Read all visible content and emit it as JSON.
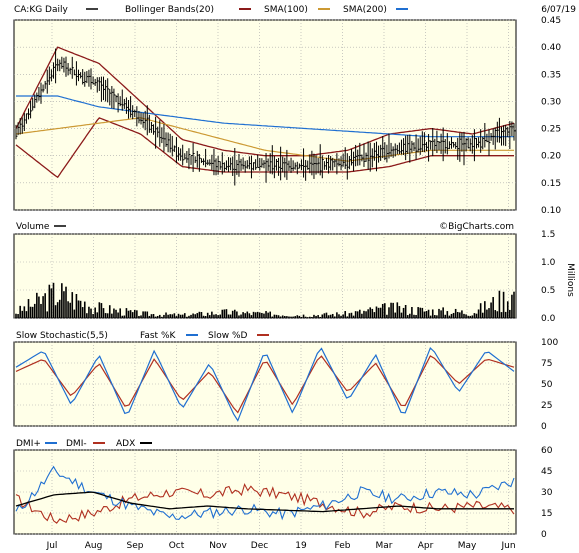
{
  "header": {
    "ticker_label": "CA:KG Daily",
    "date": "6/07/19",
    "legend": [
      {
        "label": "Bollinger Bands(20)",
        "color": "#8b1a1a"
      },
      {
        "label": "SMA(100)",
        "color": "#aa1111"
      },
      {
        "label": "SMA(200)",
        "color": "#1f6fd1"
      }
    ]
  },
  "watermark": "©BigCharts.com",
  "colors": {
    "background": "#ffffe8",
    "price": "#000000",
    "bollinger": "#8b1a1a",
    "sma100": "#cc9933",
    "sma200": "#1f6fd1",
    "volume": "#000000",
    "fast_k": "#1f6fd1",
    "slow_d": "#b03020",
    "dmi_plus": "#1f6fd1",
    "dmi_minus": "#b03020",
    "adx": "#000000",
    "grid": "#a8a8a8"
  },
  "x_axis": {
    "labels": [
      "Jul",
      "Aug",
      "Sep",
      "Oct",
      "Nov",
      "Dec",
      "19",
      "Feb",
      "Mar",
      "Apr",
      "May",
      "Jun"
    ]
  },
  "chart_data": [
    {
      "type": "line",
      "name": "price",
      "title": "CA:KG Daily",
      "yticks": [
        "0.45",
        "0.40",
        "0.35",
        "0.30",
        "0.25",
        "0.20",
        "0.15",
        "0.10"
      ],
      "ylim": [
        0.1,
        0.45
      ],
      "categories": [
        "Jun",
        "Jul",
        "Aug",
        "Sep",
        "Oct",
        "Nov",
        "Dec",
        "19",
        "Feb",
        "Mar",
        "Apr",
        "May",
        "Jun"
      ],
      "series": [
        {
          "name": "CA:KG Daily",
          "values": [
            0.24,
            0.37,
            0.33,
            0.27,
            0.2,
            0.18,
            0.185,
            0.18,
            0.19,
            0.21,
            0.22,
            0.22,
            0.25
          ]
        },
        {
          "name": "Bollinger Bands(20) upper",
          "values": [
            0.25,
            0.4,
            0.37,
            0.3,
            0.23,
            0.21,
            0.2,
            0.2,
            0.21,
            0.24,
            0.25,
            0.24,
            0.26
          ]
        },
        {
          "name": "Bollinger Bands(20) lower",
          "values": [
            0.22,
            0.16,
            0.27,
            0.24,
            0.18,
            0.17,
            0.17,
            0.17,
            0.17,
            0.18,
            0.2,
            0.2,
            0.2
          ]
        },
        {
          "name": "SMA(100)",
          "values": [
            0.24,
            0.25,
            0.26,
            0.27,
            0.25,
            0.23,
            0.21,
            0.2,
            0.19,
            0.2,
            0.21,
            0.21,
            0.21
          ]
        },
        {
          "name": "SMA(200)",
          "values": [
            0.31,
            0.31,
            0.29,
            0.28,
            0.27,
            0.26,
            0.255,
            0.25,
            0.245,
            0.24,
            0.235,
            0.235,
            0.235
          ]
        }
      ]
    },
    {
      "type": "bar",
      "name": "volume",
      "title": "Volume",
      "yticks": [
        "1.5",
        "1.0",
        "0.5",
        "0.0"
      ],
      "ylabel": "Millions",
      "ylim": [
        0,
        1.5
      ],
      "spikes": [
        0.2,
        0.9,
        0.35,
        0.15,
        0.1,
        0.2,
        0.15,
        0.1,
        0.15,
        0.35,
        0.25,
        0.2,
        0.85
      ]
    },
    {
      "type": "line",
      "name": "stochastic",
      "title": "Slow Stochastic(5,5)",
      "legend": [
        {
          "label": "Fast %K",
          "color": "#1f6fd1"
        },
        {
          "label": "Slow %D",
          "color": "#b03020"
        }
      ],
      "yticks": [
        "100",
        "75",
        "50",
        "25",
        "0"
      ],
      "ylim": [
        0,
        100
      ],
      "series": [
        {
          "name": "Fast %K",
          "values": [
            70,
            90,
            25,
            85,
            10,
            90,
            20,
            75,
            5,
            90,
            15,
            95,
            30,
            85,
            10,
            95,
            40,
            90,
            65
          ]
        },
        {
          "name": "Slow %D",
          "values": [
            65,
            80,
            35,
            75,
            20,
            80,
            30,
            65,
            15,
            80,
            25,
            85,
            40,
            75,
            20,
            85,
            50,
            80,
            70
          ]
        }
      ]
    },
    {
      "type": "line",
      "name": "dmi",
      "title": "DMI+ DMI- ADX",
      "legend": [
        {
          "label": "DMI+",
          "color": "#1f6fd1"
        },
        {
          "label": "DMI-",
          "color": "#b03020"
        },
        {
          "label": "ADX",
          "color": "#000000"
        }
      ],
      "yticks": [
        "60",
        "45",
        "30",
        "15",
        "0"
      ],
      "ylim": [
        0,
        60
      ],
      "series": [
        {
          "name": "DMI+",
          "values": [
            15,
            45,
            30,
            20,
            12,
            15,
            18,
            14,
            20,
            30,
            25,
            30,
            28,
            38
          ]
        },
        {
          "name": "DMI-",
          "values": [
            25,
            10,
            15,
            25,
            30,
            28,
            32,
            28,
            22,
            15,
            20,
            18,
            20,
            18
          ]
        },
        {
          "name": "ADX",
          "values": [
            20,
            28,
            30,
            22,
            18,
            20,
            18,
            17,
            16,
            18,
            20,
            18,
            18,
            18
          ]
        }
      ]
    }
  ]
}
